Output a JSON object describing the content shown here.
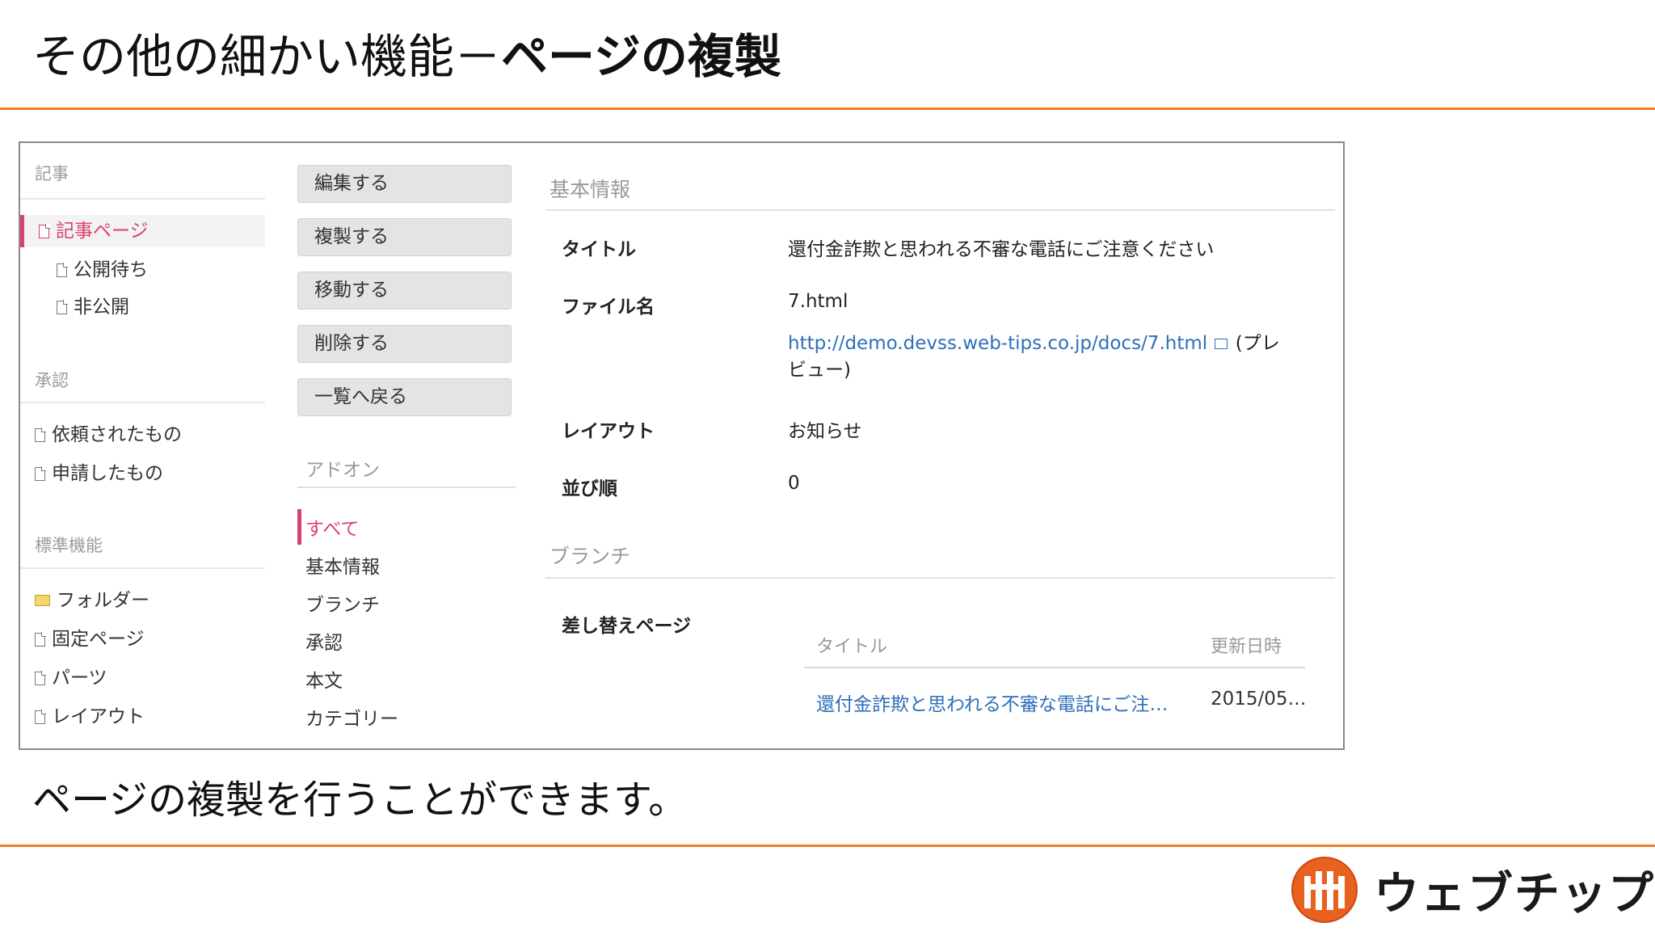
{
  "slide": {
    "title_prefix": "その他の細かい機能－",
    "title_bold": "ページの複製",
    "caption": "ページの複製を行うことができます。",
    "logo_text": "ウェブチップス"
  },
  "sidebar": {
    "sections": [
      {
        "heading": "記事",
        "items": [
          "記事ページ",
          "公開待ち",
          "非公開"
        ]
      },
      {
        "heading": "承認",
        "items": [
          "依頼されたもの",
          "申請したもの"
        ]
      },
      {
        "heading": "標準機能",
        "items": [
          "フォルダー",
          "固定ページ",
          "パーツ",
          "レイアウト"
        ]
      }
    ],
    "active_item": "記事ページ"
  },
  "actions": {
    "buttons": [
      "編集する",
      "複製する",
      "移動する",
      "削除する",
      "一覧へ戻る"
    ],
    "addon_heading": "アドオン",
    "addons": [
      "すべて",
      "基本情報",
      "ブランチ",
      "承認",
      "本文",
      "カテゴリー"
    ]
  },
  "detail": {
    "basic_heading": "基本情報",
    "fields": {
      "title_label": "タイトル",
      "title_value": "還付金詐欺と思われる不審な電話にご注意ください",
      "filename_label": "ファイル名",
      "filename_value": "7.html",
      "url": "http://demo.devss.web-tips.co.jp/docs/7.html",
      "preview_open": "(プレ",
      "preview_close": "ビュー)",
      "layout_label": "レイアウト",
      "layout_value": "お知らせ",
      "order_label": "並び順",
      "order_value": "0"
    },
    "branch_heading": "ブランチ",
    "replace_label": "差し替えページ",
    "replace_table": {
      "col_title": "タイトル",
      "col_updated": "更新日時",
      "row_title": "還付金詐欺と思われる不審な電話にご注…",
      "row_updated": "2015/05…"
    }
  },
  "colors": {
    "accent_rule": "#ee7a2a",
    "active": "#d9426c",
    "link": "#2f6fb8"
  },
  "icons": {
    "doc": "document-icon",
    "folder": "folder-icon",
    "external": "external-link-icon"
  }
}
